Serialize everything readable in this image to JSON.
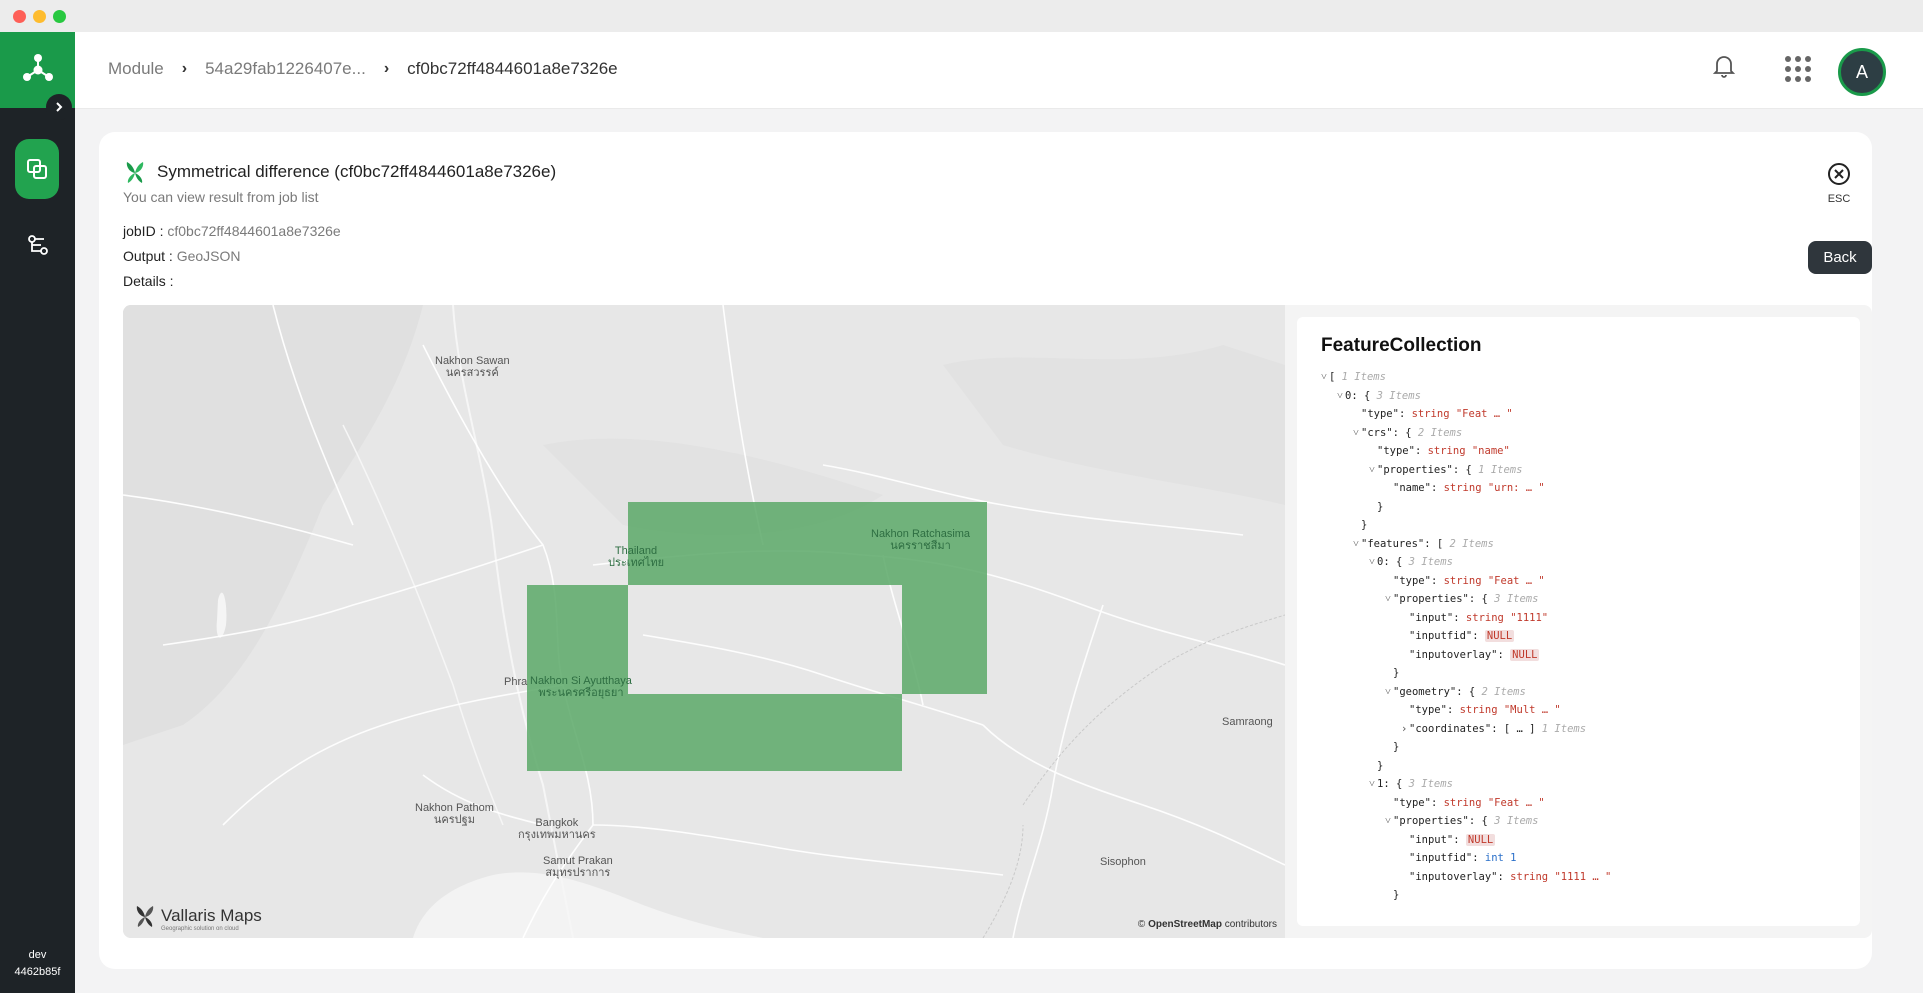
{
  "sidebar": {
    "env_name": "dev",
    "env_id": "4462b85f"
  },
  "breadcrumb": {
    "items": [
      "Module",
      "54a29fab1226407e...",
      "cf0bc72ff4844601a8e7326e"
    ]
  },
  "user": {
    "avatar_letter": "A"
  },
  "job": {
    "title": "Symmetrical difference (cf0bc72ff4844601a8e7326e)",
    "subtitle": "You can view result from job list",
    "job_id_label": "jobID :",
    "job_id": "cf0bc72ff4844601a8e7326e",
    "output_label": "Output :",
    "output": "GeoJSON",
    "details_label": "Details :",
    "esc_label": "ESC",
    "back_label": "Back"
  },
  "map": {
    "places": [
      {
        "name": "Nakhon Sawan",
        "thai": "นครสวรรค์"
      },
      {
        "name": "Thailand",
        "thai": "ประเทศไทย"
      },
      {
        "name": "Nakhon Ratchasima",
        "thai": "นครราชสีมา"
      },
      {
        "name": "Nakhon Si Ayutthaya",
        "thai": "พระนครศรีอยุธยา"
      },
      {
        "name": "Phra",
        "thai": ""
      },
      {
        "name": "Nakhon Pathom",
        "thai": "นครปฐม"
      },
      {
        "name": "Bangkok",
        "thai": "กรุงเทพมหานคร"
      },
      {
        "name": "Samut Prakan",
        "thai": "สมุทรปราการ"
      },
      {
        "name": "Samraong",
        "thai": ""
      },
      {
        "name": "Sisophon",
        "thai": ""
      }
    ],
    "brand": "Vallaris Maps",
    "brand_tag": "Geographic solution on cloud",
    "attribution_prefix": "©",
    "attribution_bold": "OpenStreetMap",
    "attribution_suffix": "contributors",
    "feature_color": "#5aa867"
  },
  "json_viewer": {
    "title": "FeatureCollection",
    "lines": [
      {
        "indent": 0,
        "toggle": "˅",
        "key": "",
        "colon": "",
        "type": "",
        "value": "[",
        "comment": "1 Items",
        "vclass": ""
      },
      {
        "indent": 1,
        "toggle": "˅",
        "key": "0",
        "colon": ":",
        "type": "",
        "value": "{",
        "comment": "3 Items",
        "vclass": ""
      },
      {
        "indent": 2,
        "toggle": "",
        "key": "\"type\"",
        "colon": ":",
        "type": "string",
        "value": "\"Feat … \"",
        "comment": "",
        "vclass": "s"
      },
      {
        "indent": 2,
        "toggle": "˅",
        "key": "\"crs\"",
        "colon": ":",
        "type": "",
        "value": "{",
        "comment": "2 Items",
        "vclass": ""
      },
      {
        "indent": 3,
        "toggle": "",
        "key": "\"type\"",
        "colon": ":",
        "type": "string",
        "value": "\"name\"",
        "comment": "",
        "vclass": "s"
      },
      {
        "indent": 3,
        "toggle": "˅",
        "key": "\"properties\"",
        "colon": ":",
        "type": "",
        "value": "{",
        "comment": "1 Items",
        "vclass": ""
      },
      {
        "indent": 4,
        "toggle": "",
        "key": "\"name\"",
        "colon": ":",
        "type": "string",
        "value": "\"urn: … \"",
        "comment": "",
        "vclass": "s"
      },
      {
        "indent": 3,
        "toggle": "",
        "key": "",
        "colon": "",
        "type": "",
        "value": "}",
        "comment": "",
        "vclass": ""
      },
      {
        "indent": 2,
        "toggle": "",
        "key": "",
        "colon": "",
        "type": "",
        "value": "}",
        "comment": "",
        "vclass": ""
      },
      {
        "indent": 2,
        "toggle": "˅",
        "key": "\"features\"",
        "colon": ":",
        "type": "",
        "value": "[",
        "comment": "2 Items",
        "vclass": ""
      },
      {
        "indent": 3,
        "toggle": "˅",
        "key": "0",
        "colon": ":",
        "type": "",
        "value": "{",
        "comment": "3 Items",
        "vclass": ""
      },
      {
        "indent": 4,
        "toggle": "",
        "key": "\"type\"",
        "colon": ":",
        "type": "string",
        "value": "\"Feat … \"",
        "comment": "",
        "vclass": "s"
      },
      {
        "indent": 4,
        "toggle": "˅",
        "key": "\"properties\"",
        "colon": ":",
        "type": "",
        "value": "{",
        "comment": "3 Items",
        "vclass": ""
      },
      {
        "indent": 5,
        "toggle": "",
        "key": "\"input\"",
        "colon": ":",
        "type": "string",
        "value": "\"1111\"",
        "comment": "",
        "vclass": "s"
      },
      {
        "indent": 5,
        "toggle": "",
        "key": "\"inputfid\"",
        "colon": ":",
        "type": "",
        "value": "NULL",
        "comment": "",
        "vclass": "n"
      },
      {
        "indent": 5,
        "toggle": "",
        "key": "\"inputoverlay\"",
        "colon": ":",
        "type": "",
        "value": "NULL",
        "comment": "",
        "vclass": "n"
      },
      {
        "indent": 4,
        "toggle": "",
        "key": "",
        "colon": "",
        "type": "",
        "value": "}",
        "comment": "",
        "vclass": ""
      },
      {
        "indent": 4,
        "toggle": "˅",
        "key": "\"geometry\"",
        "colon": ":",
        "type": "",
        "value": "{",
        "comment": "2 Items",
        "vclass": ""
      },
      {
        "indent": 5,
        "toggle": "",
        "key": "\"type\"",
        "colon": ":",
        "type": "string",
        "value": "\"Mult … \"",
        "comment": "",
        "vclass": "s"
      },
      {
        "indent": 5,
        "toggle": "›",
        "key": "\"coordinates\"",
        "colon": ":",
        "type": "",
        "value": "[ … ]",
        "comment": "1 Items",
        "vclass": ""
      },
      {
        "indent": 4,
        "toggle": "",
        "key": "",
        "colon": "",
        "type": "",
        "value": "}",
        "comment": "",
        "vclass": ""
      },
      {
        "indent": 3,
        "toggle": "",
        "key": "",
        "colon": "",
        "type": "",
        "value": "}",
        "comment": "",
        "vclass": ""
      },
      {
        "indent": 3,
        "toggle": "˅",
        "key": "1",
        "colon": ":",
        "type": "",
        "value": "{",
        "comment": "3 Items",
        "vclass": ""
      },
      {
        "indent": 4,
        "toggle": "",
        "key": "\"type\"",
        "colon": ":",
        "type": "string",
        "value": "\"Feat … \"",
        "comment": "",
        "vclass": "s"
      },
      {
        "indent": 4,
        "toggle": "˅",
        "key": "\"properties\"",
        "colon": ":",
        "type": "",
        "value": "{",
        "comment": "3 Items",
        "vclass": ""
      },
      {
        "indent": 5,
        "toggle": "",
        "key": "\"input\"",
        "colon": ":",
        "type": "",
        "value": "NULL",
        "comment": "",
        "vclass": "n"
      },
      {
        "indent": 5,
        "toggle": "",
        "key": "\"inputfid\"",
        "colon": ":",
        "type": "int",
        "value": "1",
        "comment": "",
        "vclass": "i"
      },
      {
        "indent": 5,
        "toggle": "",
        "key": "\"inputoverlay\"",
        "colon": ":",
        "type": "string",
        "value": "\"1111 … \"",
        "comment": "",
        "vclass": "s"
      },
      {
        "indent": 4,
        "toggle": "",
        "key": "",
        "colon": "",
        "type": "",
        "value": "}",
        "comment": "",
        "vclass": ""
      }
    ]
  }
}
